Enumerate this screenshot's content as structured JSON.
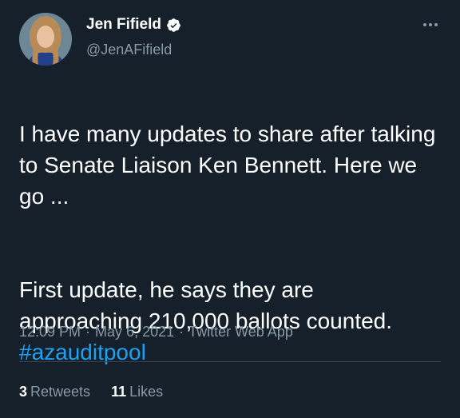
{
  "author": {
    "display_name": "Jen Fifield",
    "handle": "@JenAFifield",
    "verified": true
  },
  "tweet": {
    "paragraph1": "I have many updates to share after talking to Senate Liaison Ken Bennett. Here we go ...",
    "paragraph2_text": "First update, he says they are approaching 210,000 ballots counted. ",
    "hashtag": "#azauditpool"
  },
  "meta": {
    "time": "12:09 PM",
    "date": "May 6, 2021",
    "source": "Twitter Web App",
    "separator": "·"
  },
  "stats": {
    "retweets_count": "3",
    "retweets_label": "Retweets",
    "likes_count": "11",
    "likes_label": "Likes"
  },
  "icons": {
    "more": "more-horizontal-icon",
    "verified": "verified-badge-icon"
  },
  "colors": {
    "background": "#15202b",
    "text": "#ffffff",
    "secondary": "#8899a6",
    "link": "#1da1f2",
    "divider": "#38444d"
  }
}
